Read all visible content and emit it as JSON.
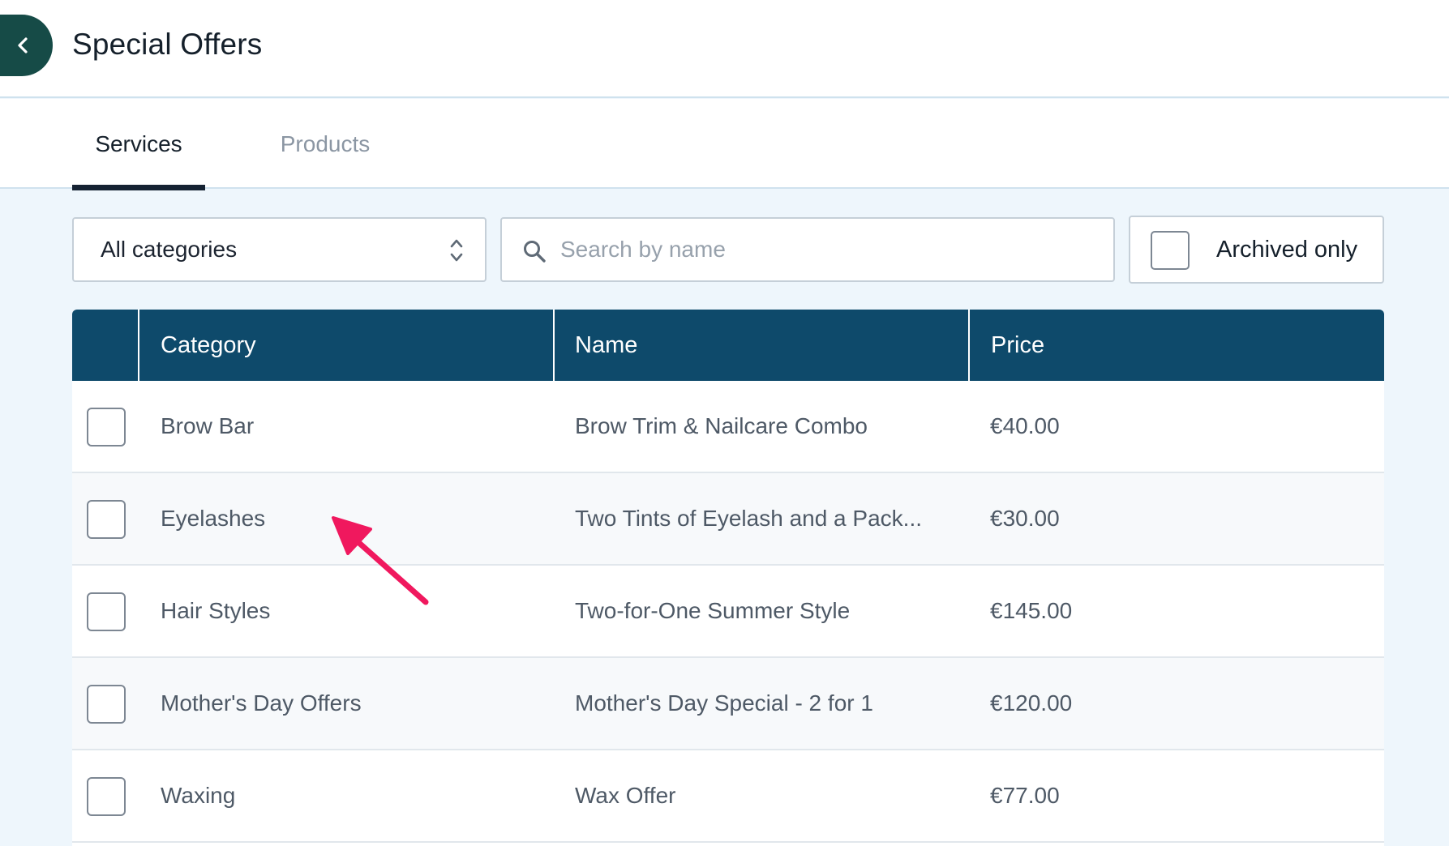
{
  "header": {
    "title": "Special Offers",
    "back_icon": "chevron-left-icon",
    "back_color": "#164b47"
  },
  "tabs": [
    {
      "label": "Services",
      "active": true
    },
    {
      "label": "Products",
      "active": false
    }
  ],
  "filters": {
    "category_select": {
      "selected": "All categories",
      "icon": "sort-updown-icon"
    },
    "search": {
      "placeholder": "Search by name",
      "value": "",
      "icon": "search-icon"
    },
    "archived_checkbox": {
      "label": "Archived only",
      "checked": false
    }
  },
  "table": {
    "header_color": "#0e4a6b",
    "columns": [
      "Category",
      "Name",
      "Price"
    ],
    "rows": [
      {
        "category": "Brow Bar",
        "name": "Brow Trim & Nailcare Combo",
        "price": "€40.00",
        "checked": false
      },
      {
        "category": "Eyelashes",
        "name": "Two Tints of Eyelash and a Pack...",
        "price": "€30.00",
        "checked": false
      },
      {
        "category": "Hair Styles",
        "name": "Two-for-One Summer Style",
        "price": "€145.00",
        "checked": false
      },
      {
        "category": "Mother's Day Offers",
        "name": "Mother's Day Special - 2 for 1",
        "price": "€120.00",
        "checked": false
      },
      {
        "category": "Waxing",
        "name": "Wax Offer",
        "price": "€77.00",
        "checked": false
      }
    ]
  },
  "annotation": {
    "icon": "pointer-arrow",
    "color": "#f0185e"
  }
}
